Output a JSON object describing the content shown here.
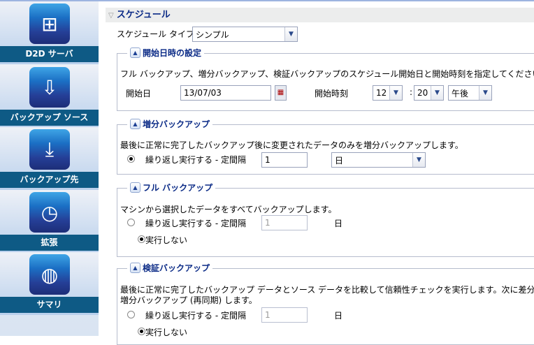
{
  "sidebar": {
    "items": [
      {
        "label": "D2D サーバ",
        "icon": "server-tree-icon"
      },
      {
        "label": "バックアップ ソース",
        "icon": "drive-download-icon"
      },
      {
        "label": "バックアップ先",
        "icon": "drive-destination-icon"
      },
      {
        "label": "拡張",
        "icon": "clock-icon"
      },
      {
        "label": "サマリ",
        "icon": "globe-icon"
      }
    ]
  },
  "schedule": {
    "title": "スケジュール",
    "type_label": "スケジュール タイプ",
    "type_value": "シンプル",
    "start": {
      "title": "開始日時の設定",
      "desc": "フル バックアップ、増分バックアップ、検証バックアップのスケジュール開始日と開始時刻を指定してください。",
      "date_label": "開始日",
      "date_value": "13/07/03",
      "time_label": "開始時刻",
      "hour": "12",
      "sep": ":",
      "minute": "20",
      "ampm": "午後"
    },
    "incremental": {
      "title": "増分バックアップ",
      "desc": "最後に正常に完了したバックアップ後に変更されたデータのみを増分バックアップします。",
      "repeat_label": "繰り返し実行する - 定間隔",
      "interval": "1",
      "unit": "日"
    },
    "full": {
      "title": "フル バックアップ",
      "desc": "マシンから選択したデータをすべてバックアップします。",
      "repeat_label": "繰り返し実行する - 定間隔",
      "interval": "1",
      "unit": "日",
      "never_label": "実行しない"
    },
    "verify": {
      "title": "検証バックアップ",
      "desc1": "最後に正常に完了したバックアップ データとソース データを比較して信頼性チェックを実行します。次に差分のみを",
      "desc2": "増分バックアップ (再同期) します。",
      "repeat_label": "繰り返し実行する - 定間隔",
      "interval": "1",
      "unit": "日",
      "never_label": "実行しない"
    }
  }
}
